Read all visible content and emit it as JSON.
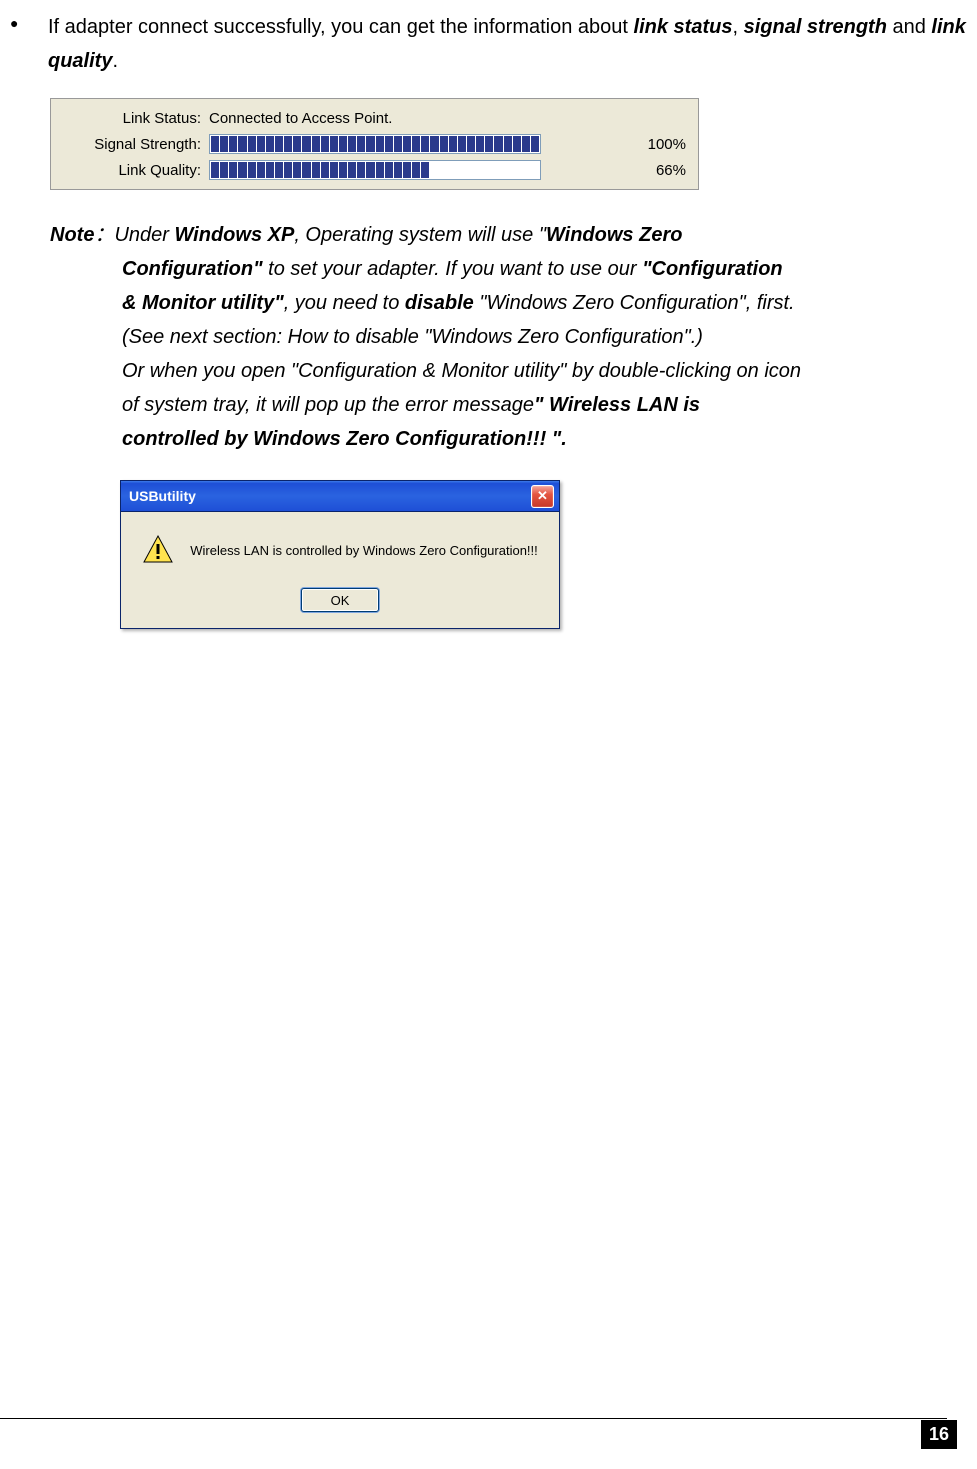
{
  "bullet": {
    "text_p1": "If adapter connect successfully, you can get the information about ",
    "bi1": "link status",
    "comma": ", ",
    "bi2": "signal strength",
    "and": " and ",
    "bi3": "link quality",
    "period": "."
  },
  "status_panel": {
    "labels": {
      "link_status": "Link Status:",
      "signal_strength": "Signal Strength:",
      "link_quality": "Link Quality:"
    },
    "link_status_value": "Connected to Access Point.",
    "signal_percent": "100%",
    "quality_percent": "66%"
  },
  "chart_data": [
    {
      "type": "bar",
      "title": "Signal Strength",
      "categories": [
        "Signal Strength"
      ],
      "values": [
        100
      ],
      "ylim": [
        0,
        100
      ],
      "ylabel": "%"
    },
    {
      "type": "bar",
      "title": "Link Quality",
      "categories": [
        "Link Quality"
      ],
      "values": [
        66
      ],
      "ylim": [
        0,
        100
      ],
      "ylabel": "%"
    }
  ],
  "note": {
    "prefix": "Note",
    "colon": "：",
    "l1_a": "Under ",
    "l1_b": "Windows XP",
    "l1_c": ", Operating system will use \"",
    "l1_d": "Windows Zero ",
    "l2_a": "Configuration\"",
    "l2_b": " to set your adapter. If you want to use our ",
    "l2_c": "\"Configuration ",
    "l3_a": "& Monitor utility\"",
    "l3_b": ", you need to ",
    "l3_c": "disable",
    "l3_d": " \"Windows Zero Configuration\", first. ",
    "l4": "(See next section: How to disable \"Windows Zero Configuration\".)",
    "l5": "Or when you open \"Configuration & Monitor utility\" by double-clicking on icon ",
    "l6_a": "of system tray, it will pop up the error message",
    "l6_b": "\" Wireless LAN is ",
    "l7": "controlled by Windows Zero Configuration!!! \"."
  },
  "dialog": {
    "title": "USButility",
    "message": "Wireless LAN is controlled by Windows Zero Configuration!!!",
    "ok": "OK",
    "close": "✕"
  },
  "page_number": "16"
}
